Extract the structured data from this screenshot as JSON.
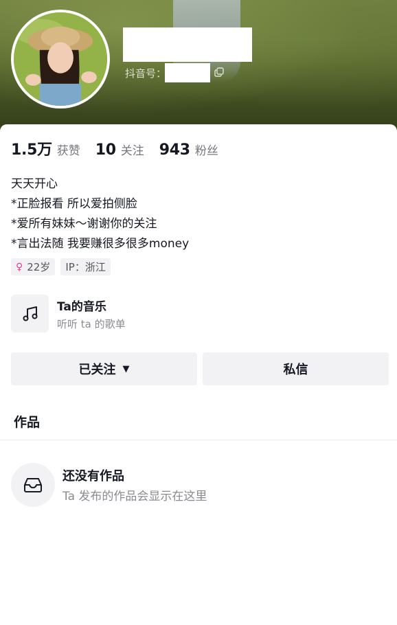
{
  "header": {
    "douyin_id_label": "抖音号："
  },
  "stats": [
    {
      "value": "1.5万",
      "label": "获赞"
    },
    {
      "value": "10",
      "label": "关注"
    },
    {
      "value": "943",
      "label": "粉丝"
    }
  ],
  "bio": [
    "天天开心",
    "*正脸报看 所以爱拍侧脸",
    "*爱所有妹妹～谢谢你的关注",
    "*言出法随 我要赚很多很多money"
  ],
  "tags": {
    "age": "22岁",
    "ip": "IP：浙江",
    "gender_icon": "female-icon"
  },
  "music": {
    "title": "Ta的音乐",
    "subtitle": "听听 ta 的歌单",
    "icon": "music-note-icon"
  },
  "actions": {
    "follow_label": "已关注",
    "message_label": "私信"
  },
  "works": {
    "tab_label": "作品",
    "empty_title": "还没有作品",
    "empty_subtitle": "Ta 发布的作品会显示在这里",
    "empty_icon": "inbox-icon"
  },
  "colors": {
    "female_accent": "#e83c8c",
    "button_bg": "#f2f2f4",
    "muted_text": "#76777d"
  }
}
